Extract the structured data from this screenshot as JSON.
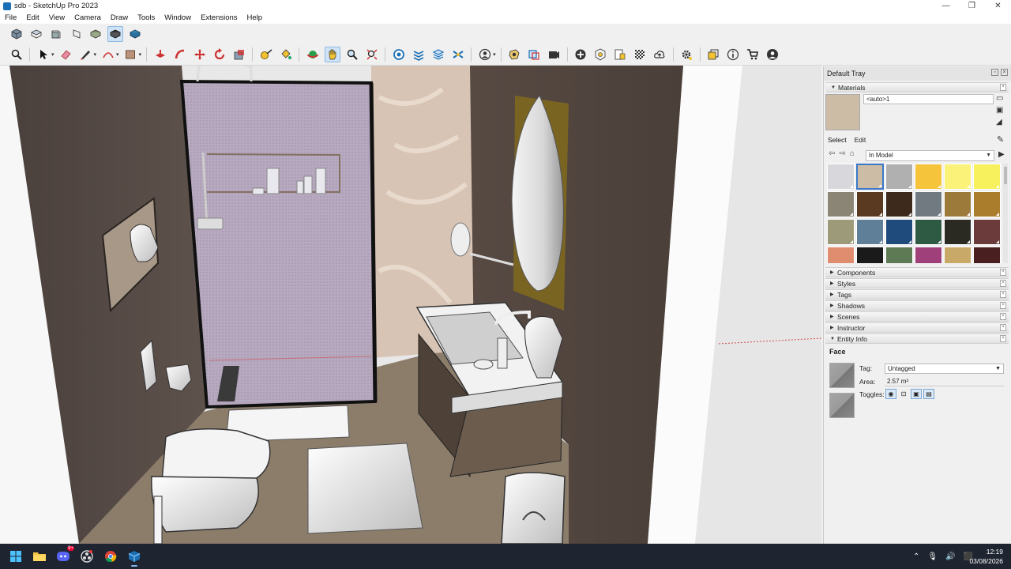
{
  "window": {
    "title": "sdb - SketchUp Pro 2023",
    "controls": [
      "—",
      "❐",
      "✕"
    ]
  },
  "menu": [
    "File",
    "Edit",
    "View",
    "Camera",
    "Draw",
    "Tools",
    "Window",
    "Extensions",
    "Help"
  ],
  "toolbar1_icons": [
    "iso-view-icon",
    "top-view-icon",
    "front-view-icon",
    "right-view-icon",
    "back-view-icon",
    "left-view-icon",
    "bottom-view-icon"
  ],
  "toolbar2_icons": [
    "search-icon",
    "select-icon",
    "eraser-icon",
    "pencil-line-icon",
    "arc-icon",
    "rectangle-icon",
    "push-pull-icon",
    "follow-me-icon",
    "move-icon",
    "rotate-icon",
    "scale-icon",
    "tape-measure-icon",
    "paint-bucket-icon",
    "orbit-icon",
    "pan-icon",
    "zoom-icon",
    "zoom-extents-icon",
    "warehouse-icon",
    "extension-warehouse-icon",
    "layout-icon",
    "section-plane-icon",
    "account-icon",
    "solid-tools-icon",
    "outer-shell-icon",
    "scene-icon",
    "add-location-icon",
    "photo-texture-icon",
    "sandbox-icon",
    "terrain-icon",
    "trimble-connect-icon",
    "settings-icon",
    "dynamic-components-icon",
    "info-icon",
    "cart-icon",
    "profile-icon"
  ],
  "tray": {
    "title": "Default Tray",
    "materials": {
      "panel_title": "Materials",
      "current_name": "<auto>1",
      "preview_color": "#ccbba5",
      "tab_select": "Select",
      "tab_edit": "Edit",
      "collection": "In Model",
      "swatches": [
        "#d8d8dc",
        "#ccbba5",
        "#b0b0b0",
        "#f5c43a",
        "#fbf27a",
        "#f6f15c",
        "#8b8576",
        "#5b3a22",
        "#3d2a1c",
        "#717a80",
        "#9b7a3a",
        "#a97d2c",
        "#9c9a78",
        "#5f7f98",
        "#1f4a7c",
        "#2e5a44",
        "#2a2a22",
        "#6b3b3b",
        "#e08c6e",
        "#1a1a1a",
        "#5e7a55",
        "#a0407a",
        "#c9a968",
        "#4a1f1f"
      ]
    },
    "panels": [
      "Components",
      "Styles",
      "Tags",
      "Shadows",
      "Scenes",
      "Instructor",
      "Entity Info"
    ],
    "entity_info": {
      "type": "Face",
      "tag_label": "Tag:",
      "tag_value": "Untagged",
      "area_label": "Area:",
      "area_value": "2.57 m²",
      "toggles_label": "Toggles:"
    }
  },
  "taskbar": {
    "apps": [
      "windows-start-icon",
      "file-explorer-icon",
      "discord-icon",
      "obs-icon",
      "chrome-icon",
      "sketchup-icon"
    ],
    "discord_badge": "9+",
    "time": "12:19",
    "date": "03/08/2026"
  }
}
